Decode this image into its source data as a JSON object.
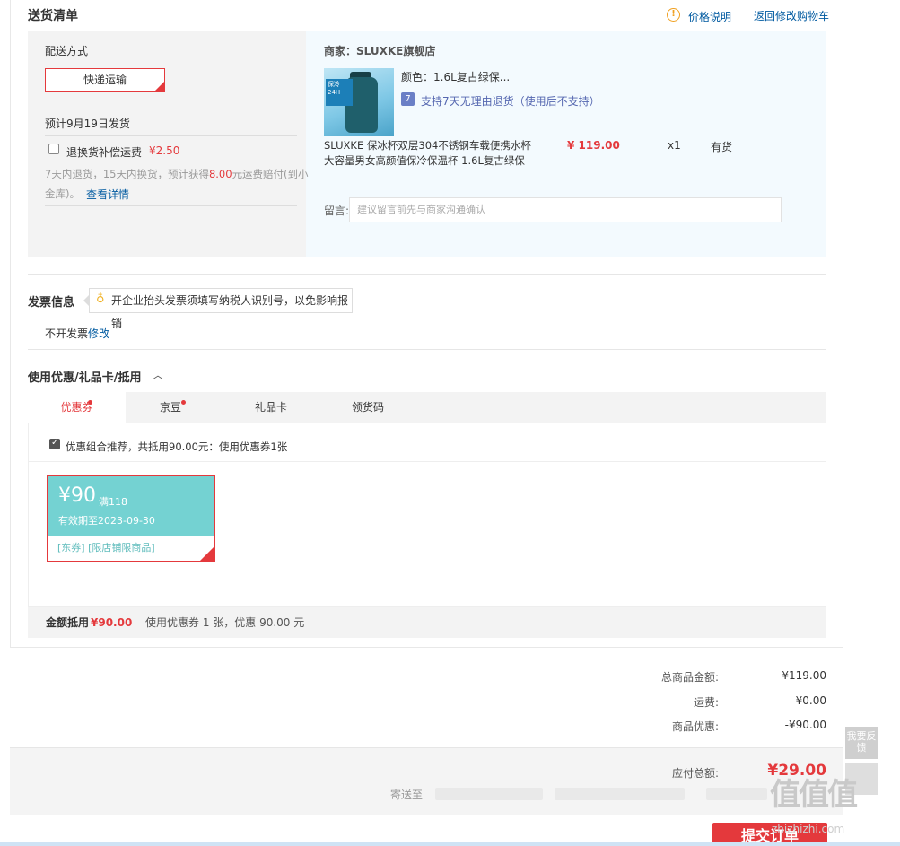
{
  "header": {
    "title": "送货清单",
    "price_note_label": "价格说明",
    "back_cart_label": "返回修改购物车"
  },
  "shipping": {
    "method_label": "配送方式",
    "method_button": "快递运输",
    "eta": "预计9月19日发货",
    "return_insurance_label": "退换货补偿运费",
    "return_insurance_price": "¥2.50",
    "return_note_pre": "7天内退货，15天内换货，预计获得",
    "return_note_amount": "8.00",
    "return_note_post": "元运费赔付(到小",
    "return_note_line2": "金库)。",
    "view_detail": "查看详情"
  },
  "seller": {
    "label": "商家：SLUXKE旗舰店",
    "product": {
      "color": "颜色：1.6L复古绿保...",
      "return_policy": "支持7天无理由退货（使用后不支持）",
      "return_icon": "7",
      "name_line1": "SLUXKE 保冰杯双层304不锈钢车载便携水杯",
      "name_line2": "大容量男女高颜值保冷保温杯 1.6L复古绿保",
      "price": "¥ 119.00",
      "qty": "x1",
      "stock": "有货",
      "image_badge": "保冷24H"
    },
    "message_label": "留言:",
    "message_placeholder": "建议留言前先与商家沟通确认"
  },
  "invoice": {
    "title": "发票信息",
    "tip": "开企业抬头发票须填写纳税人识别号，以免影响报销",
    "status": "不开发票",
    "edit": "修改"
  },
  "discount": {
    "title": "使用优惠/礼品卡/抵用",
    "tabs": [
      {
        "label": "优惠券",
        "dot": true
      },
      {
        "label": "京豆",
        "dot": true
      },
      {
        "label": "礼品卡",
        "dot": false
      },
      {
        "label": "领货码",
        "dot": false
      }
    ],
    "recommend": "优惠组合推荐，共抵用90.00元：使用优惠券1张",
    "coupon": {
      "amount": "¥90",
      "condition": "满118",
      "validity": "有效期至2023-09-30",
      "tags": "[东券] [限店铺限商品]"
    },
    "summary_label": "金额抵用",
    "summary_amount": "¥90.00",
    "summary_detail": "使用优惠券 1 张，优惠 90.00 元"
  },
  "totals": {
    "items_label": "总商品金额:",
    "items_value": "¥119.00",
    "freight_label": "运费:",
    "freight_value": "¥0.00",
    "discount_label": "商品优惠:",
    "discount_value": "-¥90.00",
    "payable_label": "应付总额:",
    "payable_value": "¥29.00",
    "ship_to_label": "寄送至",
    "submit": "提交订单"
  },
  "feedback": "我要反馈",
  "watermark": "值值值",
  "watermark_url": "zhizhizhi.com",
  "colors": {
    "accent_red": "#e4393c",
    "link_blue": "#005aa0",
    "coupon_teal": "#74d2d2"
  }
}
